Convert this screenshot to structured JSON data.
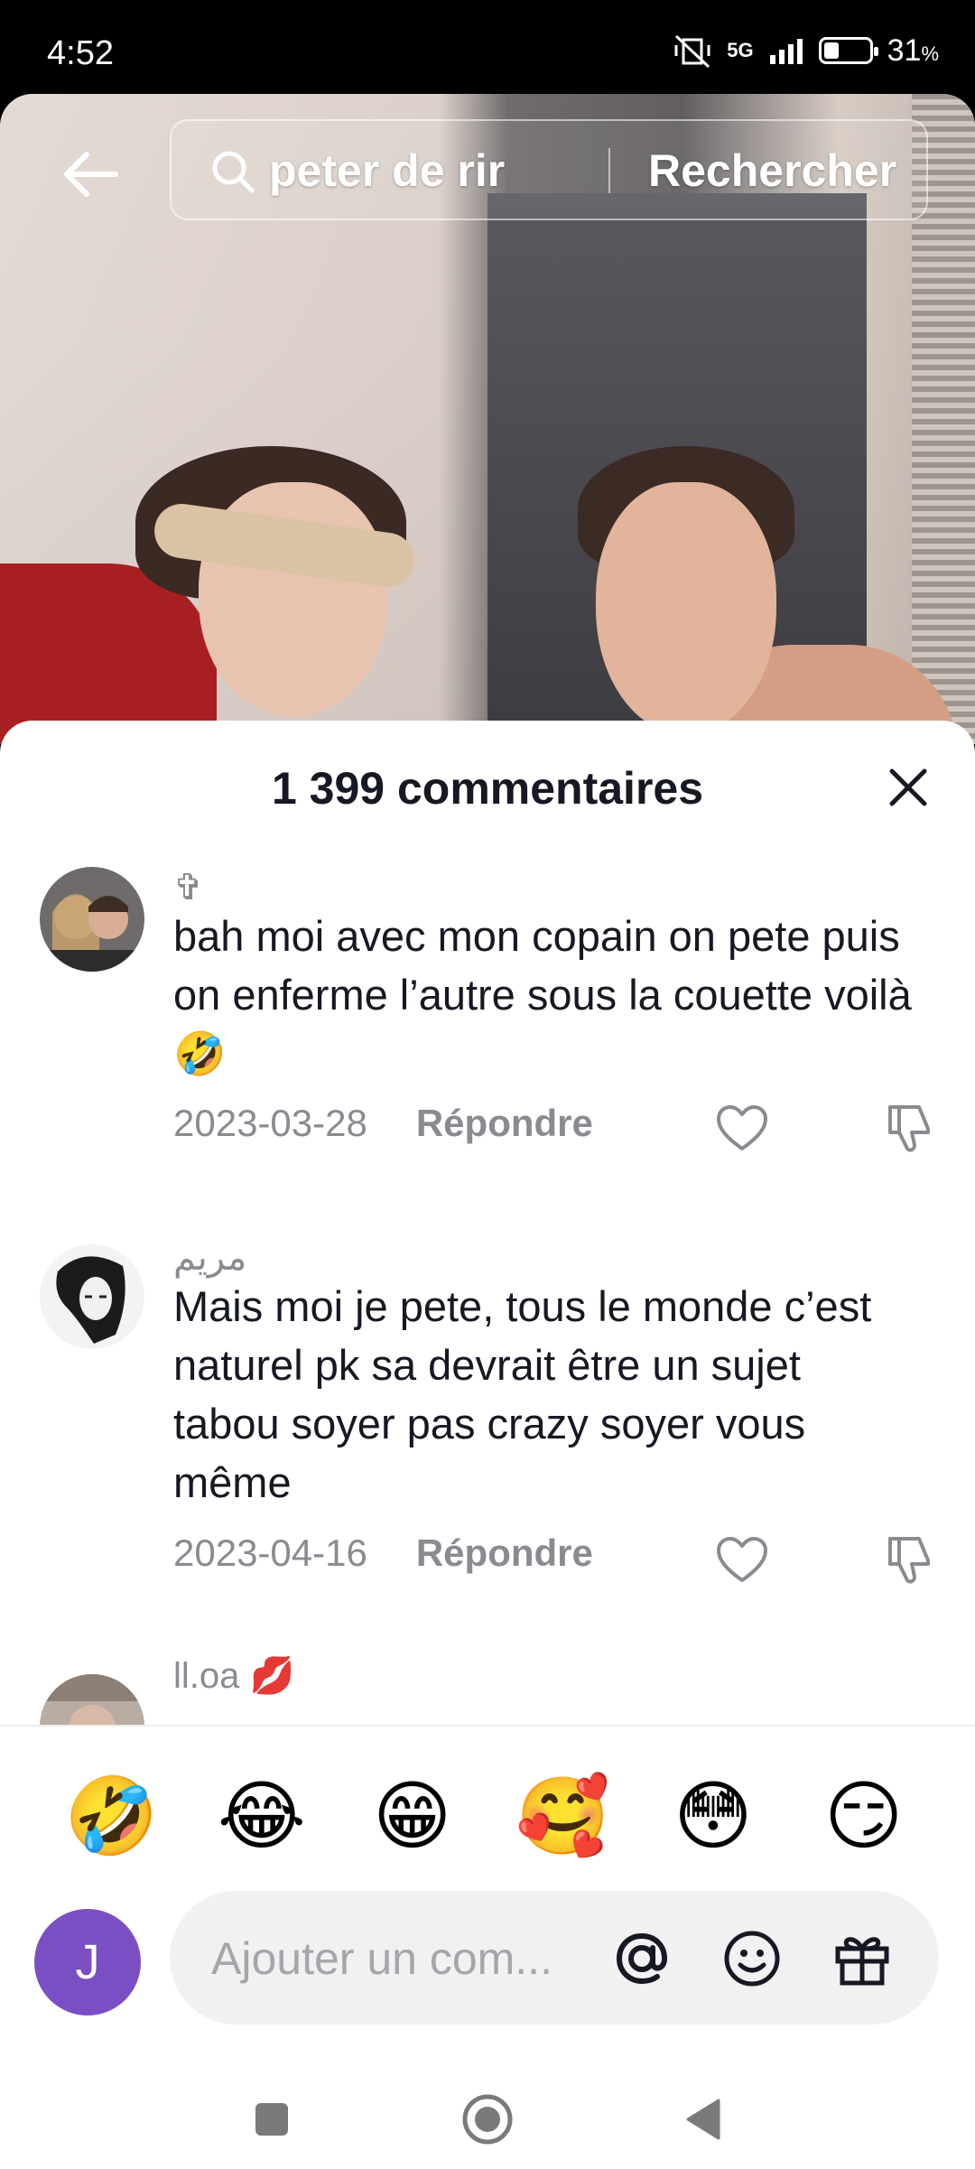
{
  "status_bar": {
    "time": "4:52",
    "network": "5G",
    "battery": "31",
    "battery_unit": "%"
  },
  "search": {
    "query": "peter de rir",
    "submit_label": "Rechercher"
  },
  "comments_sheet": {
    "title": "1 399 commentaires",
    "comments": [
      {
        "username": "✞",
        "text": "bah moi avec mon copain on pete puis on enferme l’autre sous la couette voilà 🤣",
        "date": "2023-03-28",
        "reply_label": "Répondre"
      },
      {
        "username": "مريم",
        "text": "Mais moi je pete, tous le monde c’est naturel pk sa devrait être un sujet tabou soyer pas crazy soyer vous même",
        "date": "2023-04-16",
        "reply_label": "Répondre"
      },
      {
        "username": "ll.oa 💋"
      }
    ]
  },
  "quick_emojis": [
    "🤣",
    "😂",
    "😁",
    "🥰",
    "😳",
    "😏"
  ],
  "composer": {
    "avatar_letter": "J",
    "placeholder": "Ajouter un com...",
    "avatar_color": "#7a4fc3"
  }
}
